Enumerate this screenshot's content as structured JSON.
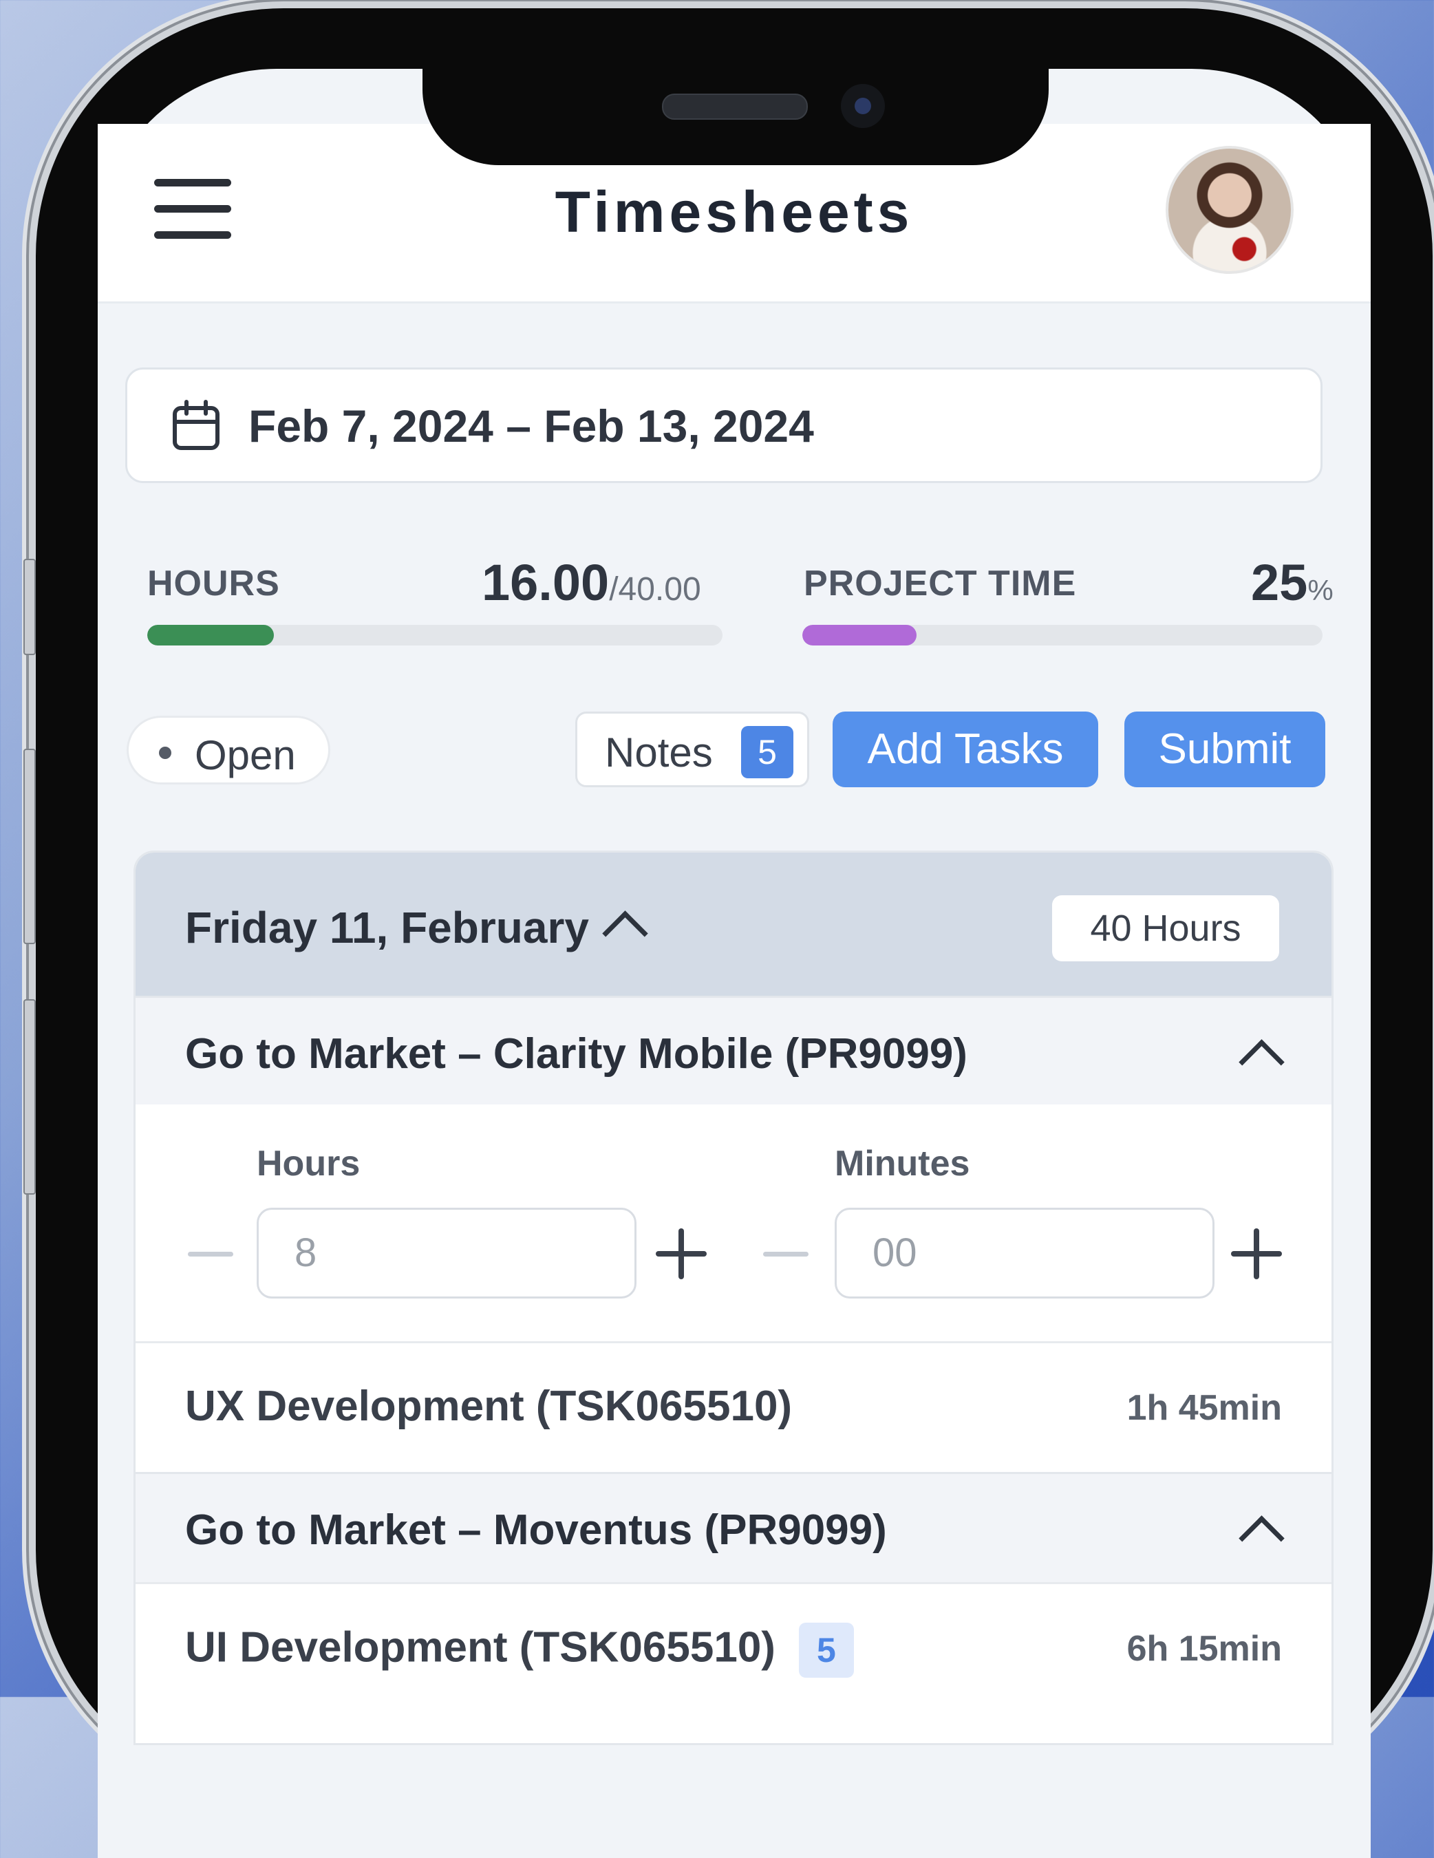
{
  "header": {
    "title": "Timesheets"
  },
  "date_range": {
    "label": "Feb 7, 2024 – Feb 13, 2024"
  },
  "stats": {
    "hours": {
      "label": "HOURS",
      "value": "16.00",
      "total": "/40.00",
      "progress": 0.22,
      "color": "#3b8f55"
    },
    "project_time": {
      "label": "PROJECT TIME",
      "value": "25",
      "unit": "%",
      "progress": 0.22,
      "color": "#b06ad8"
    }
  },
  "status": {
    "label": "Open"
  },
  "actions": {
    "notes_label": "Notes",
    "notes_count": "5",
    "add_tasks_label": "Add Tasks",
    "submit_label": "Submit"
  },
  "day": {
    "title": "Friday 11, February",
    "hours_badge": "40 Hours",
    "projects": [
      {
        "title": "Go to Market – Clarity Mobile (PR9099)",
        "entry": {
          "hours_label": "Hours",
          "hours_value": "8",
          "minutes_label": "Minutes",
          "minutes_value": "00"
        },
        "tasks": [
          {
            "title": "UX Development (TSK065510)",
            "time": "1h 45min"
          }
        ]
      },
      {
        "title": "Go to Market – Moventus (PR9099)",
        "tasks": [
          {
            "title": "UI Development (TSK065510)",
            "badge": "5",
            "time": "6h 15min"
          }
        ]
      }
    ]
  },
  "colors": {
    "accent": "#5591ec",
    "hours_bar": "#3b8f55",
    "project_bar": "#b06ad8"
  }
}
